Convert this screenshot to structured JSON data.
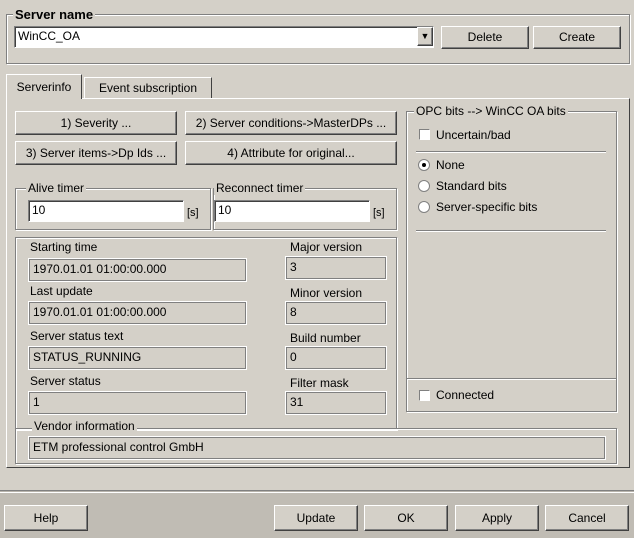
{
  "server": {
    "legend": "Server name",
    "selected": "WinCC_OA",
    "delete_label": "Delete",
    "create_label": "Create"
  },
  "tabs": [
    {
      "label": "Serverinfo",
      "active": true
    },
    {
      "label": "Event subscription",
      "active": false
    }
  ],
  "actions": {
    "severity": "1) Severity ...",
    "server_conditions": "2) Server conditions->MasterDPs ...",
    "server_items": "3) Server items->Dp Ids ...",
    "attribute": "4) Attribute for original..."
  },
  "timers": {
    "alive_label": "Alive timer",
    "alive_value": "10",
    "alive_unit": "[s]",
    "reconnect_label": "Reconnect timer",
    "reconnect_value": "10",
    "reconnect_unit": "[s]"
  },
  "status": {
    "starting_time_label": "Starting time",
    "starting_time": "1970.01.01 01:00:00.000",
    "last_update_label": "Last update",
    "last_update": "1970.01.01 01:00:00.000",
    "status_text_label": "Server status text",
    "status_text": "STATUS_RUNNING",
    "server_status_label": "Server status",
    "server_status": "1",
    "vendor_label": "Vendor information",
    "vendor": "ETM professional control GmbH",
    "major_label": "Major version",
    "major": "3",
    "minor_label": "Minor version",
    "minor": "8",
    "build_label": "Build number",
    "build": "0",
    "filter_label": "Filter mask",
    "filter": "31"
  },
  "opc": {
    "legend": "OPC bits --> WinCC OA bits",
    "uncertain_label": "Uncertain/bad",
    "uncertain_checked": false,
    "options": [
      {
        "label": "None",
        "selected": true
      },
      {
        "label": "Standard bits",
        "selected": false
      },
      {
        "label": "Server-specific bits",
        "selected": false
      }
    ],
    "connected_label": "Connected",
    "connected_checked": false
  },
  "footer": {
    "help": "Help",
    "update": "Update",
    "ok": "OK",
    "apply": "Apply",
    "cancel": "Cancel"
  }
}
